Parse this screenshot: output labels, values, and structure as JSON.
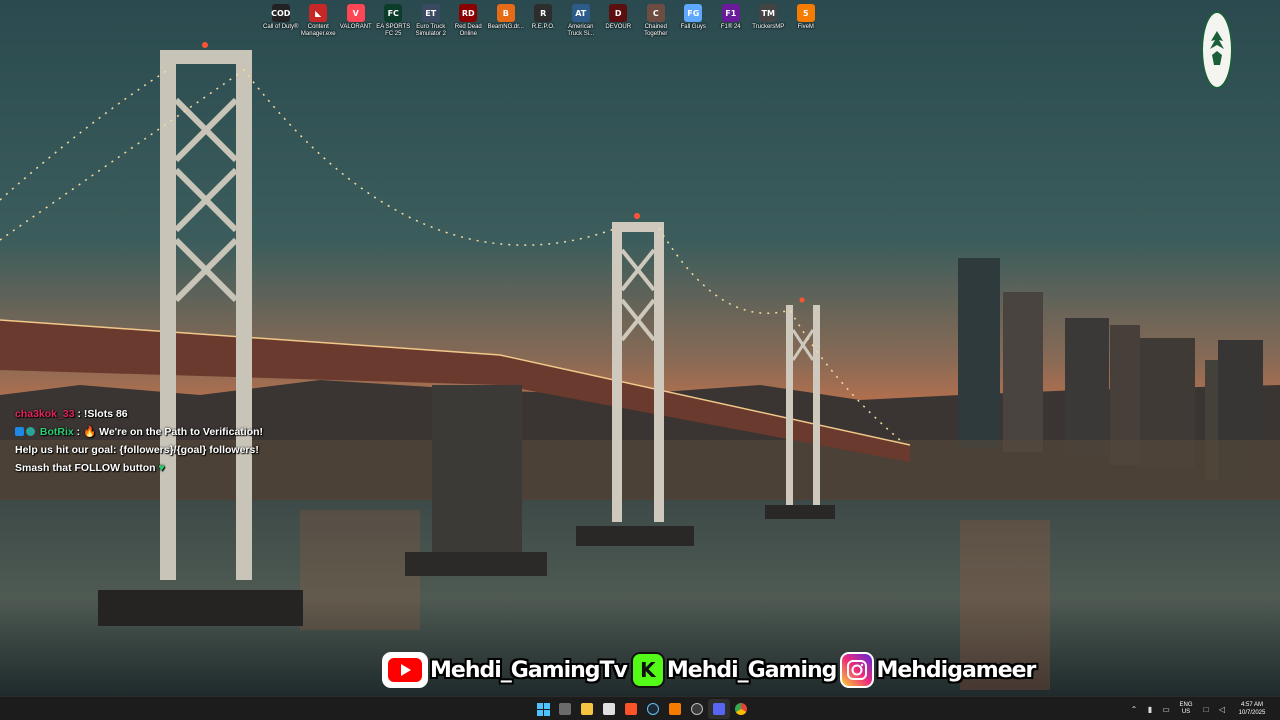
{
  "desktop_icons": [
    {
      "label": "Call of Duty®",
      "glyph": "COD",
      "color": "#222222"
    },
    {
      "label": "Content Manager.exe",
      "glyph": "◣",
      "color": "#c62828"
    },
    {
      "label": "VALORANT",
      "glyph": "V",
      "color": "#ff4655"
    },
    {
      "label": "EA SPORTS FC 25",
      "glyph": "FC",
      "color": "#0b3d2a"
    },
    {
      "label": "Euro Truck Simulator 2",
      "glyph": "ET",
      "color": "#3b4a63"
    },
    {
      "label": "Red Dead Online",
      "glyph": "RD",
      "color": "#8b0000"
    },
    {
      "label": "BeamNG.dr...",
      "glyph": "B",
      "color": "#e66b16"
    },
    {
      "label": "R.E.P.O.",
      "glyph": "R",
      "color": "#2d2d2d"
    },
    {
      "label": "American Truck Si...",
      "glyph": "AT",
      "color": "#2d5c8a"
    },
    {
      "label": "DEVOUR",
      "glyph": "D",
      "color": "#5b0f0f"
    },
    {
      "label": "Chained Together",
      "glyph": "C",
      "color": "#6d4c41"
    },
    {
      "label": "Fall Guys",
      "glyph": "FG",
      "color": "#5fa8ff"
    },
    {
      "label": "F1® 24",
      "glyph": "F1",
      "color": "#6a1b9a"
    },
    {
      "label": "TruckersMP",
      "glyph": "TM",
      "color": "#444444"
    },
    {
      "label": "FiveM",
      "glyph": "5",
      "color": "#f57c00"
    }
  ],
  "chat": {
    "msg1_user": "cha3kok_33",
    "msg1_text": ": !Slots 86",
    "msg2_user": "BotRix",
    "msg2_text": "We're on the Path to Verification!",
    "msg2_line2": "Help us hit our goal: {followers}/{goal} followers!",
    "msg2_line3": "Smash that FOLLOW button"
  },
  "social": {
    "youtube_handle": "Mehdi_GamingTv",
    "kick_handle": "Mehdi_Gaming",
    "kick_letter": "K",
    "instagram_handle": "Mehdigameer"
  },
  "tray": {
    "lang_line1": "ENG",
    "lang_line2": "US",
    "time": "4:57 AM",
    "date": "10/7/2025"
  },
  "colors": {
    "taskbar": "#1c1c1c",
    "youtube_red": "#ff0000",
    "kick_green": "#53fc18"
  }
}
